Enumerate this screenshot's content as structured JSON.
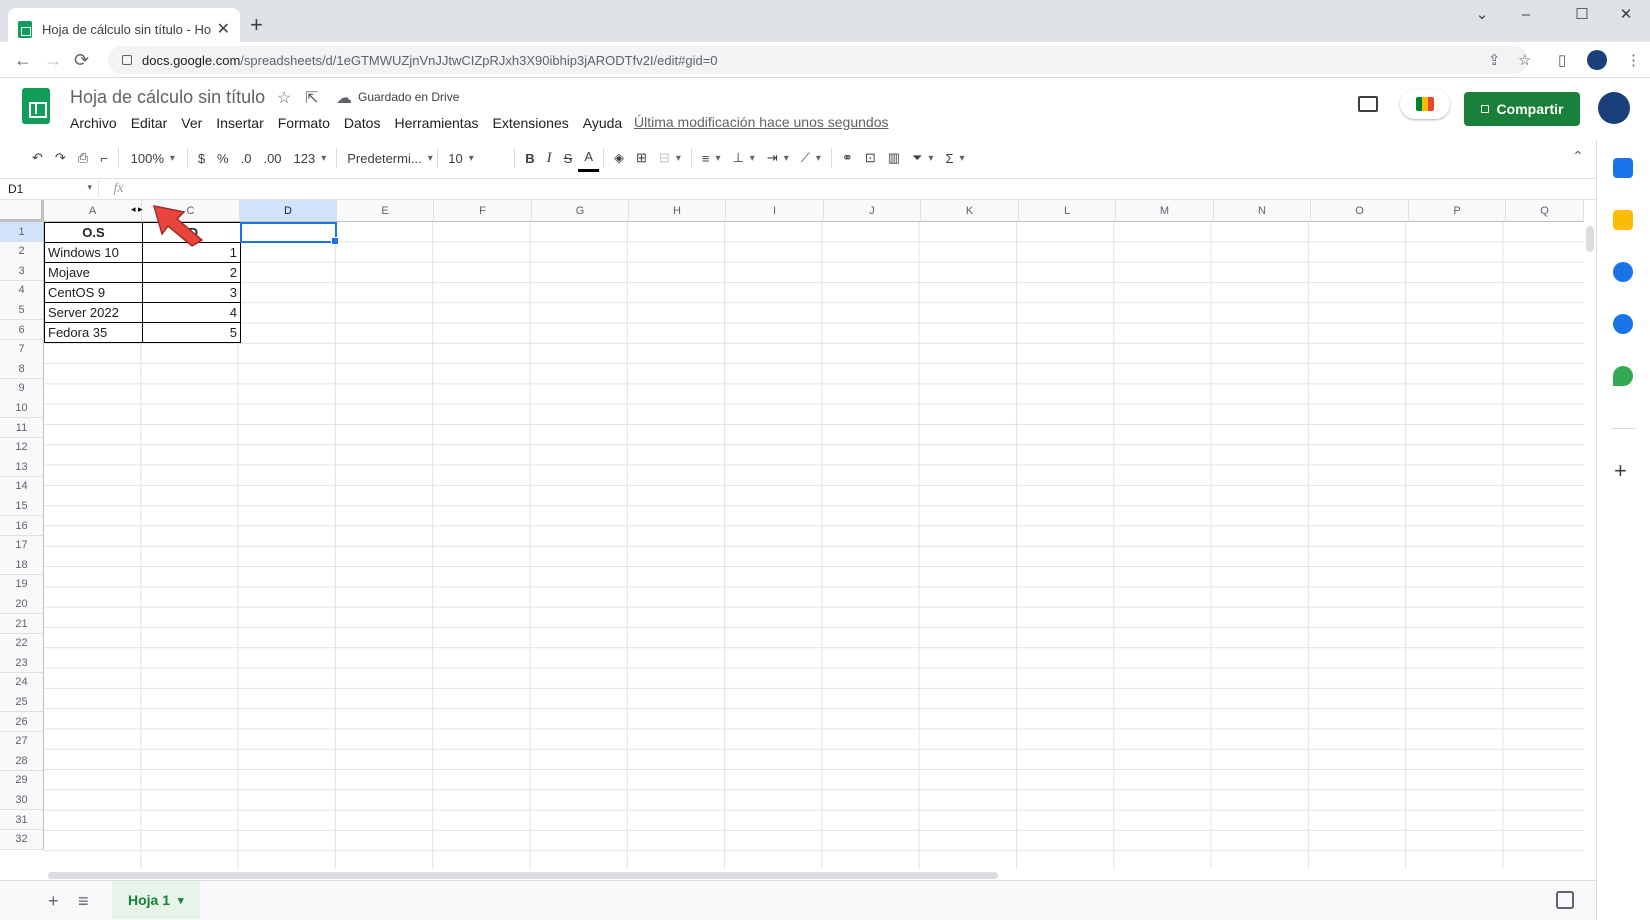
{
  "browser": {
    "tab_title": "Hoja de cálculo sin título - Hojas",
    "tab_close": "✕",
    "new_tab": "+",
    "url_host": "docs.google.com",
    "url_path": "/spreadsheets/d/1eGTMWUZjnVnJJtwCIZpRJxh3X90ibhip3jARODTfv2I/edit#gid=0",
    "back_icon": "←",
    "forward_icon": "→",
    "reload_icon": "⟳",
    "share_page_icon": "⇪",
    "star_icon": "☆",
    "sidepanel_icon": "▯",
    "menu_icon": "⋮",
    "minimize": "⌄",
    "min": "–",
    "max": "☐",
    "close": "✕"
  },
  "header": {
    "doc_title": "Hoja de cálculo sin título",
    "star_icon": "☆",
    "move_icon": "⇱",
    "cloud_icon": "☁",
    "saved_label": "Guardado en Drive",
    "menu": [
      "Archivo",
      "Editar",
      "Ver",
      "Insertar",
      "Formato",
      "Datos",
      "Herramientas",
      "Extensiones",
      "Ayuda"
    ],
    "last_modified": "Última modificación hace unos segundos",
    "share_label": "Compartir"
  },
  "toolbar": {
    "undo": "↶",
    "redo": "↷",
    "print": "⎙",
    "paint_format": "⌐",
    "zoom": "100%",
    "currency": "$",
    "percent": "%",
    "dec_decrease": ".0",
    "dec_increase": ".00",
    "more_formats": "123",
    "font": "Predetermi...",
    "font_size": "10",
    "bold": "B",
    "italic": "I",
    "strike": "S",
    "text_color": "A",
    "fill_icon": "◈",
    "borders_icon": "⊞",
    "merge_icon": "⊟",
    "align_icon": "≡",
    "valign_icon": "⊥",
    "wrap_icon": "⇥",
    "rotate_icon": "⟋",
    "link_icon": "⚭",
    "comment_icon": "⊡",
    "chart_icon": "▥",
    "filter_icon": "⏷",
    "functions_icon": "Σ",
    "collapse": "⌃"
  },
  "formula_bar": {
    "name_box": "D1",
    "fx": "fx",
    "content": ""
  },
  "columns": [
    "A",
    "C",
    "D",
    "E",
    "F",
    "G",
    "H",
    "I",
    "J",
    "K",
    "L",
    "M",
    "N",
    "O",
    "P",
    "Q"
  ],
  "selected_column": "D",
  "rows": [
    "1",
    "2",
    "3",
    "4",
    "5",
    "6",
    "7",
    "8",
    "9",
    "10",
    "11",
    "12",
    "13",
    "14",
    "15",
    "16",
    "17",
    "18",
    "19",
    "20",
    "21",
    "22",
    "23",
    "24",
    "25",
    "26",
    "27",
    "28",
    "29",
    "30",
    "31",
    "32"
  ],
  "selected_row": "1",
  "table": {
    "header": [
      "O.S",
      "ID"
    ],
    "rows": [
      [
        "Windows 10",
        "1"
      ],
      [
        "Mojave",
        "2"
      ],
      [
        "CentOS 9",
        "3"
      ],
      [
        "Server 2022",
        "4"
      ],
      [
        "Fedora 35",
        "5"
      ]
    ]
  },
  "hidden_col_arrows": "◂ ▸",
  "bottom": {
    "add_sheet": "+",
    "all_sheets": "≡",
    "sheet_tab": "Hoja 1"
  },
  "side_panel": {
    "plus": "+",
    "colors": [
      "#1a73e8",
      "#fbbc04",
      "#1a73e8",
      "#1a73e8",
      "#34a853"
    ]
  },
  "colors": {
    "accent": "#188038",
    "selection": "#1a73e8",
    "header_sel": "#d3e3fd"
  }
}
